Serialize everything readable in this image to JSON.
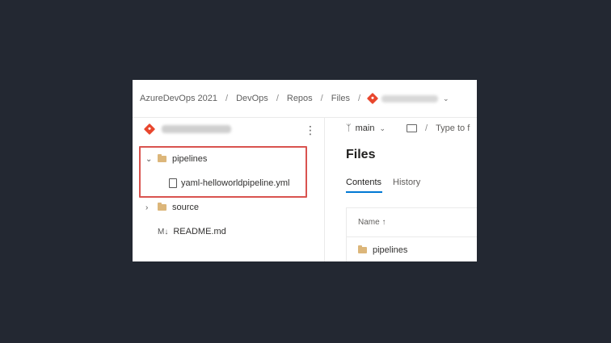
{
  "breadcrumb": {
    "items": [
      "AzureDevOps 2021",
      "DevOps",
      "Repos",
      "Files"
    ],
    "separator": "/",
    "repo_icon": "git-repo-icon"
  },
  "left_pane": {
    "more_icon": "⋮",
    "tree": {
      "pipelines_folder": "pipelines",
      "yaml_file": "yaml-helloworldpipeline.yml",
      "source_folder": "source",
      "readme_prefix": "M↓",
      "readme_file": "README.md"
    }
  },
  "right_pane": {
    "branch": "main",
    "path_placeholder": "Type to f",
    "title": "Files",
    "tabs": [
      "Contents",
      "History"
    ],
    "table": {
      "header": "Name ↑",
      "rows": [
        "pipelines"
      ]
    }
  },
  "colors": {
    "background": "#232832",
    "highlight_border": "#d9534f",
    "tab_accent": "#0078d4",
    "folder": "#dcb67a",
    "git_icon": "#e8462d"
  }
}
